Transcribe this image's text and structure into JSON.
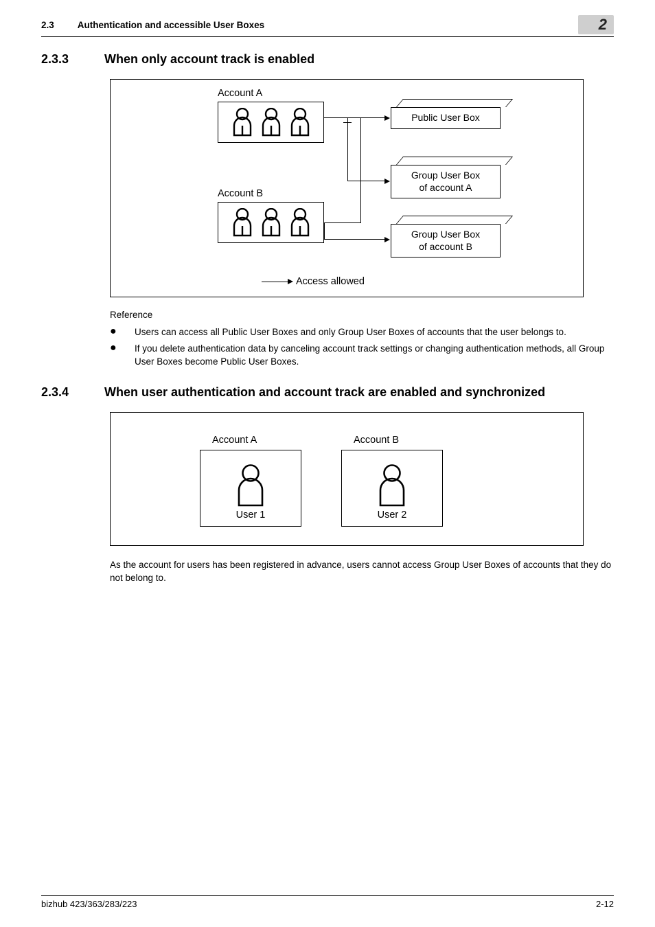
{
  "header": {
    "section_number": "2.3",
    "section_title": "Authentication and accessible User Boxes",
    "chapter": "2"
  },
  "sec1": {
    "num": "2.3.3",
    "title": "When only account track is enabled"
  },
  "diagram1": {
    "account_a": "Account A",
    "account_b": "Account B",
    "public_box": "Public User Box",
    "group_box_a_line1": "Group User Box",
    "group_box_a_line2": "of account A",
    "group_box_b_line1": "Group User Box",
    "group_box_b_line2": "of account B",
    "legend": "Access allowed"
  },
  "reference": {
    "heading": "Reference",
    "items": [
      "Users can access all Public User Boxes and only Group User Boxes of accounts that the user belongs to.",
      "If you delete authentication data by canceling account track settings or changing authentication methods, all Group User Boxes become Public User Boxes."
    ]
  },
  "sec2": {
    "num": "2.3.4",
    "title": "When user authentication and account track are enabled and synchronized"
  },
  "diagram2": {
    "account_a": "Account A",
    "account_b": "Account B",
    "user1": "User 1",
    "user2": "User 2"
  },
  "para2": "As the account for users has been registered in advance, users cannot access Group User Boxes of accounts that they do not belong to.",
  "footer": {
    "left": "bizhub 423/363/283/223",
    "right": "2-12"
  }
}
